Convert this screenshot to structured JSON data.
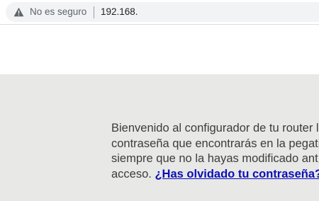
{
  "browser": {
    "security_label": "No es seguro",
    "url": "192.168.",
    "security_icon": "warning-triangle-icon"
  },
  "page": {
    "welcome_lines": [
      "Bienvenido al configurador de tu router l",
      "contraseña que encontrarás en la pegati",
      "siempre que no la hayas modificado ant",
      "acceso."
    ],
    "forgot_password_link": "¿Has olvidado tu contraseña?"
  },
  "colors": {
    "panel_background": "#e8e8e6",
    "body_text": "#3c3c3c",
    "link": "#0b0fb8",
    "omnibox_background": "#f1f3f4"
  }
}
